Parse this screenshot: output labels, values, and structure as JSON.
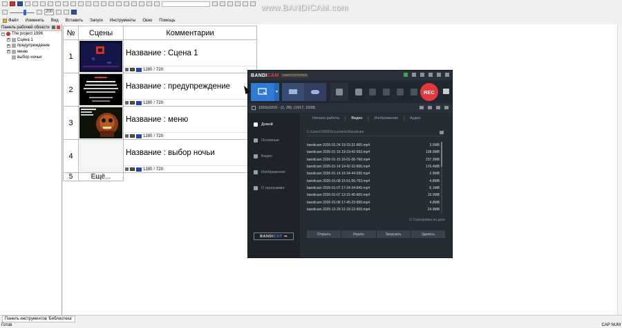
{
  "watermark": "www.BANDICAM.com",
  "toolbar": {
    "zoom_value": "200"
  },
  "menu": [
    "Файл",
    "Изменить",
    "Вид",
    "Вставить",
    "Запуск",
    "Инструменты",
    "Окно",
    "Помощь"
  ],
  "workspace": {
    "title": "Панель рабочей области",
    "project": "The project 1996",
    "items": [
      "Сцена 1",
      "предупреждение",
      "меню",
      "выбор ночьи"
    ]
  },
  "grid": {
    "headers": {
      "num": "№",
      "scenes": "Сцены",
      "comments": "Комментарии"
    },
    "rows": [
      {
        "num": "1",
        "title": "Название : Сцена 1",
        "res_w": "1280",
        "res_h": "720"
      },
      {
        "num": "2",
        "title": "Название : предупреждение",
        "res_w": "1280",
        "res_h": "720"
      },
      {
        "num": "3",
        "title": "Название : меню",
        "res_w": "1280",
        "res_h": "720"
      },
      {
        "num": "4",
        "title": "Название : выбор ночьи",
        "res_w": "1280",
        "res_h": "720"
      }
    ],
    "more": {
      "num": "5",
      "label": "Ещё..."
    },
    "res_sep": "/"
  },
  "bottom": {
    "tools_tab": "Панель инструментов 'Библиотека'",
    "status": "Готов",
    "status_right": "CAP NUM"
  },
  "bandicam": {
    "logo_a": "BANDI",
    "logo_b": "CAM",
    "unregistered": "UNREGISTERED",
    "rec_label": "REC",
    "info": "1916x1010 - (1, 28), (1917, 1038)",
    "nav": [
      "Домой",
      "Основные",
      "Видео",
      "Изображения",
      "О программе"
    ],
    "bandicut_a": "BANDI",
    "bandicut_b": "CUT",
    "bandicut_arrow": "⇒",
    "tabs": [
      "Начало работы",
      "Видео",
      "Изображения",
      "Аудио"
    ],
    "path": "C:\\Users\\TRW\\Documents\\Bandicam",
    "files": [
      {
        "name": "bandicam 2026-01-24 19-33-31-865.mp4",
        "size": "3.6MB"
      },
      {
        "name": "bandicam 2026-01-16 19-23-42-933.mp4",
        "size": "108.0MB"
      },
      {
        "name": "bandicam 2026-01-15 16-01-06-768.mp4",
        "size": "237.3MB"
      },
      {
        "name": "bandicam 2026-01-14 19-42-10-806.mp4",
        "size": "176.4MB"
      },
      {
        "name": "bandicam 2026-01-14 16-34-44-930.mp4",
        "size": "2.9MB"
      },
      {
        "name": "bandicam 2026-01-08 15-51-56-793.mp4",
        "size": "4.8MB"
      },
      {
        "name": "bandicam 2026-01-07 17-24-34-849.mp4",
        "size": "6.1MB"
      },
      {
        "name": "bandicam 2026-01-07 13-15-40-869.mp4",
        "size": "19.0MB"
      },
      {
        "name": "bandicam 2026-01-06 17-45-23-899.mp4",
        "size": "4.8MB"
      },
      {
        "name": "bandicam 2025-12-29 12-18-12-903.mp4",
        "size": "24.9MB"
      }
    ],
    "sort_label": "Сортировка по дате",
    "actions": [
      "Открыть",
      "Играть",
      "Загрузить",
      "Удалить"
    ]
  },
  "colors": {
    "rec": "#e23a3a",
    "accent": "#2f7bd6",
    "bandicam_bg": "#222831"
  }
}
